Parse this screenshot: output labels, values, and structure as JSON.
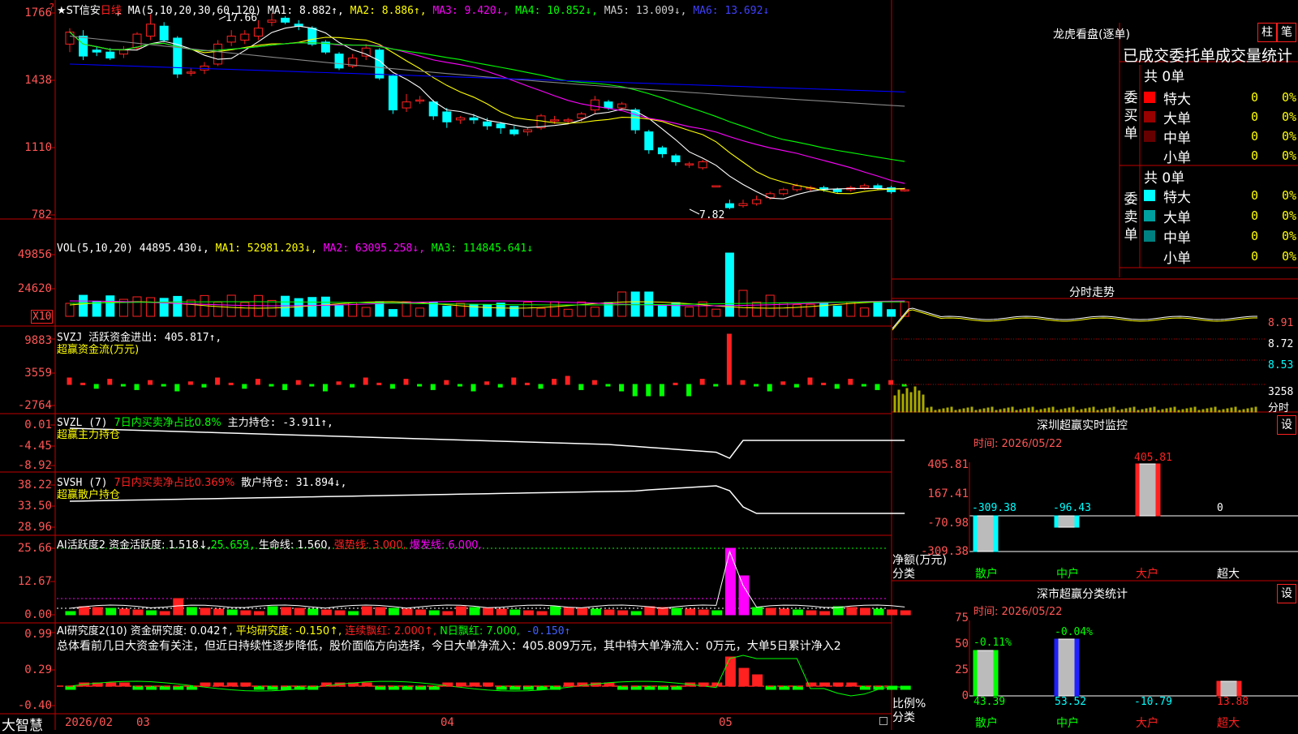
{
  "colors": {
    "up": "#ff2020",
    "down": "#00ffff",
    "grid": "#c00000",
    "ma1": "#ffffff",
    "ma2": "#ffff00",
    "ma3": "#ff00ff",
    "ma4": "#00ff00",
    "ma5": "#888888",
    "ma6": "#0000ff"
  },
  "header": {
    "title": "★ST信安",
    "period": "日线",
    "ma_label": "MA(5,10,20,30,60,120)",
    "ma1": "MA1: 8.882↑,",
    "ma2": "MA2: 8.886↑,",
    "ma3": "MA3: 9.420↓,",
    "ma4": "MA4: 10.852↓,",
    "ma5": "MA5: 13.009↓,",
    "ma6": "MA6: 13.692↓",
    "high_mark": "17.66",
    "low_mark": "7.82"
  },
  "price_axis": [
    "1766",
    "1438",
    "1110",
    "782"
  ],
  "vol": {
    "label": "VOL(5,10,20)",
    "value": "44895.430↓,",
    "ma1": "MA1: 52981.203↓,",
    "ma2": "MA2: 63095.258↓,",
    "ma3": "MA3: 114845.641↓",
    "axis": [
      "49856",
      "24620",
      "X10"
    ]
  },
  "svzj": {
    "label": "SVZJ  活跃资金进出: 405.817↑,",
    "sub": "超赢资金流(万元)",
    "axis": [
      "9883",
      "3559",
      "-2764"
    ]
  },
  "svzl": {
    "label1": "SVZL (7) ",
    "label2": "7日内买卖净占比0.8%",
    "label3": " 主力持仓: -3.911↑,",
    "sub": "超赢主力持仓",
    "axis": [
      "0.01",
      "-4.45",
      "-8.92"
    ]
  },
  "svsh": {
    "label1": "SVSH (7) ",
    "label2": "7日内买卖净占比0.369%",
    "label3": " 散户持仓: 31.894↓,",
    "sub": "超赢散户持仓",
    "axis": [
      "38.22",
      "33.50",
      "28.96"
    ]
  },
  "ai1": {
    "l1": "AI活跃度2 资金活跃度: 1.518↓,",
    "l2": "25.659,",
    "l3": " 生命线: 1.560,",
    "l4": " 强势线: 3.000,",
    "l5": " 爆发线: 6.000,",
    "axis": [
      "25.66",
      "12.67",
      "0.00"
    ]
  },
  "ai2": {
    "l1": "AI研究度2(10) 资金研究度: 0.042↑,",
    "l2": " 平均研究度: -0.150↑,",
    "l3": " 连续飘红: 2.000↑,",
    "l4": " N日飘红: 7.000,",
    "l5": " -0.150↑",
    "desc": "总体看前几日大资金有关注，但近日持续性逐步降低，股价面临方向选择，今日大单净流入：405.809万元，其中特大单净流入：0万元，大单5日累计净入2",
    "axis": [
      "0.99",
      "0.29",
      "-0.40"
    ]
  },
  "date_axis": {
    "brand": "大智慧",
    "d1": "2026/02",
    "d2": "03",
    "d3": "04",
    "d4": "05"
  },
  "right": {
    "title": "龙虎看盘(逐单)",
    "btn1": "柱",
    "btn2": "笔",
    "tabs": "已成交委托单成交量统计",
    "buy_total": "共 0单",
    "buy_side": "委买单",
    "sell_total": "共 0单",
    "sell_side": "委卖单",
    "rows": [
      {
        "name": "特大",
        "v": "0",
        "p": "0%"
      },
      {
        "name": "大单",
        "v": "0",
        "p": "0%"
      },
      {
        "name": "中单",
        "v": "0",
        "p": "0%"
      },
      {
        "name": "小单",
        "v": "0",
        "p": "0%"
      }
    ],
    "intraday_title": "分时走势",
    "intraday_axis": [
      "8.91",
      "8.72",
      "8.53",
      "3258",
      "分时"
    ],
    "sz_monitor": {
      "title": "深圳超赢实时监控",
      "btn": "设",
      "time": "时间: 2026/05/22",
      "axis": [
        "405.81",
        "167.41",
        "-70.98",
        "-309.38"
      ],
      "ylabel1": "净额(万元)",
      "ylabel2": "分类",
      "cats": [
        "散户",
        "中户",
        "大户",
        "超大"
      ],
      "vals": [
        "-309.38",
        "-96.43",
        "405.81",
        "0"
      ]
    },
    "sz_class": {
      "title": "深市超赢分类统计",
      "btn": "设",
      "time": "时间: 2026/05/22",
      "axis": [
        "75",
        "50",
        "25",
        "0"
      ],
      "ylabel1": "比例%",
      "ylabel2": "分类",
      "cats": [
        "散户",
        "中户",
        "大户",
        "超大"
      ],
      "top": [
        "-0.11%",
        "-0.04%",
        "",
        ""
      ],
      "bottom": [
        "43.39",
        "53.52",
        "-10.79",
        "13.88"
      ]
    }
  },
  "chart_data": {
    "type": "line",
    "title": "",
    "price_axis_ticks": [
      1766,
      1438,
      1110,
      782
    ],
    "ma_series": [
      {
        "name": "MA1",
        "last": 8.882
      },
      {
        "name": "MA2",
        "last": 8.886
      },
      {
        "name": "MA3",
        "last": 9.42
      },
      {
        "name": "MA4",
        "last": 10.852
      },
      {
        "name": "MA5",
        "last": 13.009
      },
      {
        "name": "MA6",
        "last": 13.692
      }
    ],
    "candles": [
      [
        16.1,
        16.7,
        15.7,
        16.9
      ],
      [
        16.5,
        15.5,
        15.3,
        16.8
      ],
      [
        15.8,
        15.7,
        15.5,
        16.0
      ],
      [
        15.7,
        15.4,
        15.3,
        15.9
      ],
      [
        15.6,
        15.8,
        15.4,
        16.0
      ],
      [
        15.9,
        16.6,
        15.8,
        16.7
      ],
      [
        16.5,
        17.1,
        16.3,
        17.6
      ],
      [
        17.0,
        16.3,
        16.2,
        17.2
      ],
      [
        16.4,
        14.6,
        14.4,
        16.5
      ],
      [
        14.7,
        14.7,
        14.5,
        14.9
      ],
      [
        14.8,
        15.0,
        14.6,
        15.2
      ],
      [
        15.1,
        16.1,
        15.0,
        16.3
      ],
      [
        16.2,
        16.5,
        16.0,
        16.8
      ],
      [
        16.3,
        16.6,
        16.1,
        16.8
      ],
      [
        16.5,
        16.9,
        16.3,
        17.3
      ],
      [
        17.2,
        17.3,
        17.0,
        17.66
      ],
      [
        17.4,
        17.2,
        17.1,
        17.5
      ],
      [
        17.1,
        17.0,
        16.8,
        17.3
      ],
      [
        16.9,
        16.1,
        16.0,
        17.0
      ],
      [
        16.2,
        15.7,
        15.6,
        16.3
      ],
      [
        15.6,
        14.9,
        14.8,
        15.7
      ],
      [
        15.0,
        15.4,
        14.9,
        15.6
      ],
      [
        15.5,
        15.9,
        15.3,
        16.1
      ],
      [
        15.8,
        14.4,
        14.3,
        15.9
      ],
      [
        14.5,
        12.8,
        12.6,
        14.6
      ],
      [
        12.9,
        13.2,
        12.7,
        13.6
      ],
      [
        13.3,
        13.3,
        13.1,
        13.5
      ],
      [
        13.2,
        12.5,
        12.3,
        13.3
      ],
      [
        12.7,
        12.2,
        11.9,
        12.9
      ],
      [
        12.3,
        12.4,
        12.1,
        12.5
      ],
      [
        12.4,
        12.3,
        12.1,
        12.6
      ],
      [
        12.2,
        12.0,
        11.8,
        12.4
      ],
      [
        12.1,
        11.9,
        11.6,
        12.2
      ],
      [
        11.8,
        11.6,
        11.5,
        12.0
      ],
      [
        11.7,
        11.8,
        11.5,
        11.9
      ],
      [
        11.9,
        12.5,
        11.8,
        12.6
      ],
      [
        12.3,
        12.3,
        12.1,
        12.5
      ],
      [
        12.3,
        12.3,
        12.1,
        12.4
      ],
      [
        12.4,
        12.6,
        12.2,
        12.7
      ],
      [
        12.8,
        13.3,
        12.6,
        13.5
      ],
      [
        13.2,
        12.9,
        12.8,
        13.3
      ],
      [
        12.9,
        13.1,
        12.8,
        13.2
      ],
      [
        12.8,
        11.8,
        11.6,
        12.9
      ],
      [
        11.7,
        10.8,
        10.6,
        11.8
      ],
      [
        10.9,
        10.6,
        10.4,
        11.0
      ],
      [
        10.5,
        10.2,
        10.0,
        10.6
      ],
      [
        10.1,
        10.1,
        9.9,
        10.2
      ],
      [
        9.9,
        10.2,
        9.8,
        10.3
      ],
      [
        9.0,
        9.0,
        9.0,
        9.0
      ],
      [
        8.1,
        7.9,
        7.82,
        8.3
      ],
      [
        8.0,
        8.1,
        7.9,
        8.3
      ],
      [
        8.1,
        8.3,
        8.0,
        8.5
      ],
      [
        8.4,
        8.6,
        8.3,
        8.7
      ],
      [
        8.6,
        8.8,
        8.5,
        8.9
      ],
      [
        8.8,
        9.0,
        8.7,
        9.1
      ],
      [
        8.9,
        8.9,
        8.7,
        9.0
      ],
      [
        8.9,
        8.8,
        8.7,
        9.0
      ],
      [
        8.8,
        8.7,
        8.6,
        8.9
      ],
      [
        8.8,
        8.9,
        8.7,
        9.0
      ],
      [
        8.9,
        9.0,
        8.8,
        9.1
      ],
      [
        9.0,
        8.9,
        8.8,
        9.1
      ],
      [
        8.9,
        8.7,
        8.6,
        9.0
      ],
      [
        8.8,
        8.8,
        8.7,
        8.9
      ]
    ],
    "volume_axis_ticks": [
      49856,
      24620
    ],
    "svzj_axis_ticks": [
      9883,
      3559,
      -2764
    ],
    "svzl_axis_ticks": [
      0.01,
      -4.45,
      -8.92
    ],
    "svsh_axis_ticks": [
      38.22,
      33.5,
      28.96
    ],
    "ai1_axis_ticks": [
      25.66,
      12.67,
      0.0
    ],
    "ai2_axis_ticks": [
      0.99,
      0.29,
      -0.4
    ],
    "sz_monitor": {
      "type": "bar",
      "categories": [
        "散户",
        "中户",
        "大户",
        "超大"
      ],
      "values": [
        -309.38,
        -96.43,
        405.81,
        0
      ],
      "ylim": [
        -309.38,
        405.81
      ]
    },
    "sz_class": {
      "type": "bar",
      "categories": [
        "散户",
        "中户",
        "大户",
        "超大"
      ],
      "values": [
        43.39,
        53.52,
        -10.79,
        13.88
      ],
      "ylim": [
        0,
        75
      ]
    }
  }
}
